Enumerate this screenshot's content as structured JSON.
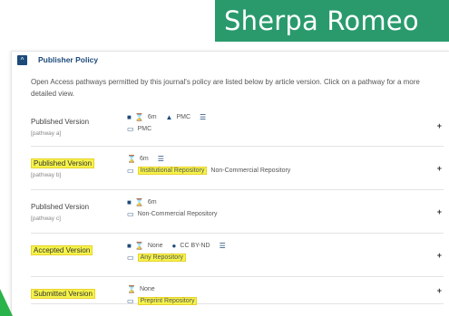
{
  "brand": "Sherpa Romeo",
  "panel": {
    "title": "Publisher Policy",
    "intro": "Open Access pathways permitted by this journal's policy are listed below by article version. Click on a pathway for a more detailed view."
  },
  "rows": [
    {
      "version": "Published Version",
      "pathway": "[pathway a]",
      "embargo": "6m",
      "repo_badge": "PMC",
      "location": "PMC",
      "expand": "+"
    },
    {
      "version": "Published Version",
      "pathway": "[pathway b]",
      "embargo": "6m",
      "location_hl": "Institutional Repository",
      "location_rest": "Non-Commercial Repository",
      "expand": "+"
    },
    {
      "version": "Published Version",
      "pathway": "[pathway c]",
      "embargo": "6m",
      "location": "Non-Commercial Repository",
      "expand": "+"
    },
    {
      "version": "Accepted Version",
      "embargo": "None",
      "license": "CC BY-ND",
      "location_hl": "Any Repository",
      "expand": "+"
    },
    {
      "version": "Submitted Version",
      "embargo": "None",
      "location_hl": "Preprint Repository",
      "expand": "+"
    }
  ]
}
